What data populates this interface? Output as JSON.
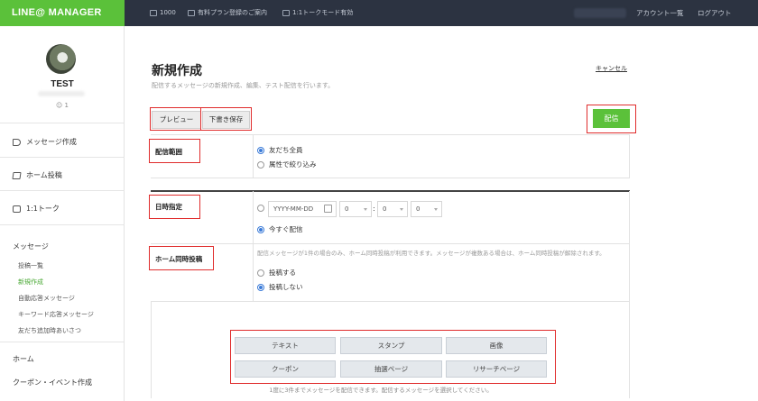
{
  "topbar": {
    "logo": "LINE@ MANAGER",
    "message_count": "1000",
    "plan_notice": "有料プラン登録のご案内",
    "talk_mode": "1:1トークモード有効",
    "account_list": "アカウント一覧",
    "logout": "ログアウト"
  },
  "sidebar": {
    "username": "TEST",
    "followers": "1",
    "main_items": [
      "メッセージ作成",
      "ホーム投稿",
      "1:1トーク"
    ],
    "section_message": "メッセージ",
    "sub_items": [
      "投稿一覧",
      "新規作成",
      "自動応答メッセージ",
      "キーワード応答メッセージ",
      "友だち追加時あいさつ"
    ],
    "active_sub_item": "新規作成",
    "section_home": "ホーム",
    "section_coupon": "クーポン・イベント作成"
  },
  "main": {
    "title": "新規作成",
    "description": "配信するメッセージの新規作成、編集、テスト配信を行います。",
    "cancel": "キャンセル",
    "preview_button": "プレビュー",
    "draft_button": "下書き保存",
    "send_button": "配信",
    "delivery_range": {
      "label": "配信範囲",
      "options": [
        "友だち全員",
        "属性で絞り込み"
      ],
      "selected": "友だち全員"
    },
    "schedule": {
      "label": "日時指定",
      "date_placeholder": "YYYY-MM-DD",
      "hour": "0",
      "minute": "0",
      "third": "0",
      "now_option": "今すぐ配信",
      "selected": "今すぐ配信"
    },
    "home_post": {
      "label": "ホーム同時投稿",
      "note": "配信メッセージが1件の場合のみ、ホーム同時投稿が利用できます。メッセージが複数ある場合は、ホーム同時投稿が解除されます。",
      "options": [
        "投稿する",
        "投稿しない"
      ],
      "selected": "投稿しない"
    },
    "content_types": [
      "テキスト",
      "スタンプ",
      "画像",
      "クーポン",
      "抽選ページ",
      "リサーチページ"
    ],
    "footer_note": "1度に3件までメッセージを配信できます。配信するメッセージを選択してください。"
  },
  "colors": {
    "brand_green": "#5bc13a",
    "topbar_bg": "#2c3341",
    "highlight_red": "#e02c2c",
    "radio_blue": "#3b7bd8"
  }
}
